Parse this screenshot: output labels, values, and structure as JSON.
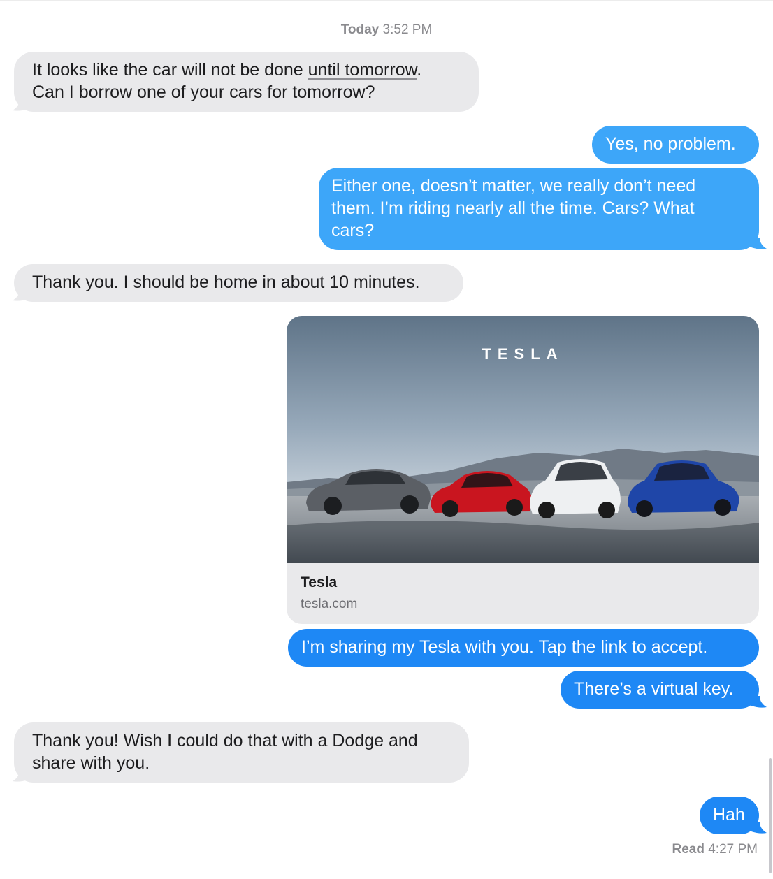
{
  "header": {
    "date_label": "Today",
    "time_label": "3:52 PM"
  },
  "messages": [
    {
      "direction": "incoming",
      "line1_pre": "It looks like the car will not be done ",
      "line1_link": "until tomorrow",
      "line1_post": ".",
      "line2": "Can I borrow one of your cars for tomorrow?"
    },
    {
      "direction": "outgoing",
      "text": "Yes, no problem."
    },
    {
      "direction": "outgoing",
      "line1": "Either one, doesn’t matter, we really don’t need",
      "line2": "them.  I’m riding nearly all the time.  Cars?  What",
      "line3": "cars?"
    },
    {
      "direction": "incoming",
      "text": "Thank you. I should be home in about 10 minutes."
    },
    {
      "direction": "outgoing",
      "text": "I’m sharing my Tesla with you. Tap the link to accept."
    },
    {
      "direction": "outgoing",
      "text": "There’s a virtual key."
    },
    {
      "direction": "incoming",
      "line1": "Thank you! Wish I could do that with a Dodge and",
      "line2": "share with you."
    },
    {
      "direction": "outgoing",
      "text": "Hah"
    }
  ],
  "link_preview": {
    "logo_text": "TESLA",
    "title": "Tesla",
    "url": "tesla.com"
  },
  "receipt": {
    "status": "Read",
    "time": "4:27 PM"
  },
  "colors": {
    "incoming_bubble": "#e9e9eb",
    "outgoing_bubble": "#1e88f5",
    "outgoing_bubble_light": "#3da6f9",
    "meta_text": "#8a8a8e"
  }
}
